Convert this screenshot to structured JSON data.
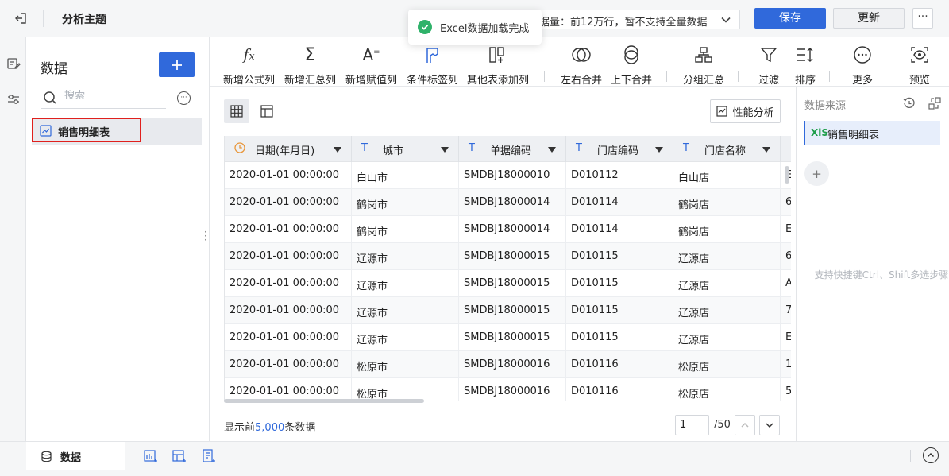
{
  "header": {
    "title": "分析主题",
    "notice": "据量：前12万行，暂不支持全量数据",
    "save_label": "保存",
    "update_label": "更新",
    "more_label": "···"
  },
  "toast": {
    "message": "Excel数据加载完成"
  },
  "sidebar": {
    "title": "数据",
    "add_label": "+",
    "search_placeholder": "搜索",
    "tables": [
      {
        "name": "销售明细表",
        "selected": true
      }
    ]
  },
  "toolbar": {
    "items": [
      {
        "label": "新增公式列",
        "icon": "fx-icon"
      },
      {
        "label": "新增汇总列",
        "icon": "sigma-icon"
      },
      {
        "label": "新增赋值列",
        "icon": "assign-icon"
      },
      {
        "label": "条件标签列",
        "icon": "flag-icon"
      },
      {
        "label": "其他表添加列",
        "icon": "add-column-icon"
      },
      {
        "label": "左右合并",
        "icon": "merge-horizontal-icon"
      },
      {
        "label": "上下合并",
        "icon": "merge-vertical-icon"
      },
      {
        "label": "分组汇总",
        "icon": "group-icon"
      },
      {
        "label": "过滤",
        "icon": "filter-icon"
      },
      {
        "label": "排序",
        "icon": "sort-icon"
      },
      {
        "label": "更多",
        "icon": "more-icon"
      },
      {
        "label": "预览",
        "icon": "preview-icon"
      }
    ]
  },
  "main": {
    "perf_label": "性能分析",
    "columns": [
      {
        "label": "日期(年月日)",
        "type": "date"
      },
      {
        "label": "城市",
        "type": "text"
      },
      {
        "label": "单据编码",
        "type": "text"
      },
      {
        "label": "门店编码",
        "type": "text"
      },
      {
        "label": "门店名称",
        "type": "text"
      }
    ],
    "rows": [
      [
        "2020-01-01 00:00:00",
        "白山市",
        "SMDBJ18000010",
        "D010112",
        "白山店",
        "E"
      ],
      [
        "2020-01-01 00:00:00",
        "鹤岗市",
        "SMDBJ18000014",
        "D010114",
        "鹤岗店",
        "6"
      ],
      [
        "2020-01-01 00:00:00",
        "鹤岗市",
        "SMDBJ18000014",
        "D010114",
        "鹤岗店",
        "E"
      ],
      [
        "2020-01-01 00:00:00",
        "辽源市",
        "SMDBJ18000015",
        "D010115",
        "辽源店",
        "6"
      ],
      [
        "2020-01-01 00:00:00",
        "辽源市",
        "SMDBJ18000015",
        "D010115",
        "辽源店",
        "A"
      ],
      [
        "2020-01-01 00:00:00",
        "辽源市",
        "SMDBJ18000015",
        "D010115",
        "辽源店",
        "7"
      ],
      [
        "2020-01-01 00:00:00",
        "辽源市",
        "SMDBJ18000015",
        "D010115",
        "辽源店",
        "E"
      ],
      [
        "2020-01-01 00:00:00",
        "松原市",
        "SMDBJ18000016",
        "D010116",
        "松原店",
        "1"
      ],
      [
        "2020-01-01 00:00:00",
        "松原市",
        "SMDBJ18000016",
        "D010116",
        "松原店",
        "5"
      ]
    ],
    "footer": {
      "prefix": "显示前",
      "count": "5,000",
      "suffix": "条数据",
      "page": "1",
      "total_pages": "/50"
    }
  },
  "right_panel": {
    "title": "数据来源",
    "source_badge": "XlS",
    "source_name": "销售明细表",
    "add_label": "+",
    "hint": "支持快捷键Ctrl、Shift多选步骤"
  },
  "bottom": {
    "tab_label": "数据"
  },
  "colors": {
    "accent": "#3069db",
    "success": "#2fb26a",
    "highlight_border": "#e0201d"
  }
}
